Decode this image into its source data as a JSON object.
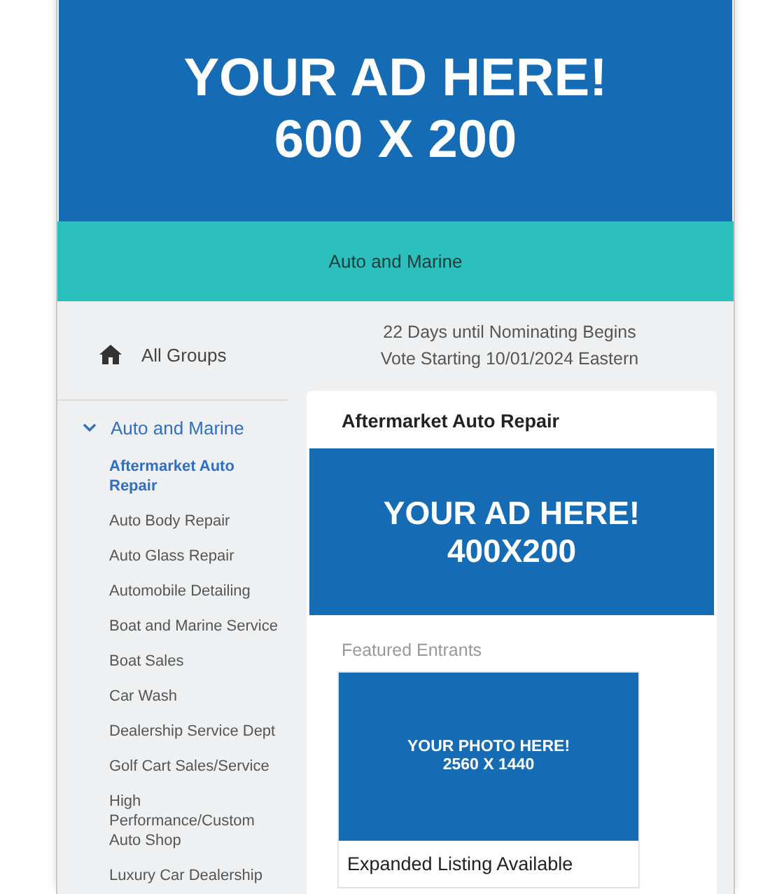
{
  "top_ad": {
    "lines": [
      "YOUR AD HERE!",
      "600 X 200"
    ]
  },
  "group_banner": {
    "title": "Auto and Marine"
  },
  "sidebar": {
    "home": {
      "label": "All Groups"
    },
    "group": {
      "label": "Auto and Marine",
      "expanded": true,
      "items": [
        {
          "label": "Aftermarket Auto Repair",
          "selected": true
        },
        {
          "label": "Auto Body Repair",
          "selected": false
        },
        {
          "label": "Auto Glass Repair",
          "selected": false
        },
        {
          "label": "Automobile Detailing",
          "selected": false
        },
        {
          "label": "Boat and Marine Service",
          "selected": false
        },
        {
          "label": "Boat Sales",
          "selected": false
        },
        {
          "label": "Car Wash",
          "selected": false
        },
        {
          "label": "Dealership Service Dept",
          "selected": false
        },
        {
          "label": "Golf Cart Sales/Service",
          "selected": false
        },
        {
          "label": "High Performance/Custom Auto Shop",
          "selected": false
        },
        {
          "label": "Luxury Car Dealership",
          "selected": false
        }
      ]
    }
  },
  "countdown": [
    "22 Days until Nominating Begins",
    "Vote Starting 10/01/2024 Eastern"
  ],
  "category": {
    "title": "Aftermarket Auto Repair",
    "ad_lines": [
      "YOUR AD HERE!",
      "400X200"
    ],
    "featured_heading": "Featured Entrants",
    "entrants": [
      {
        "photo_lines": [
          "YOUR PHOTO HERE!",
          "2560 X 1440"
        ],
        "caption": "Expanded Listing Available"
      }
    ]
  }
}
